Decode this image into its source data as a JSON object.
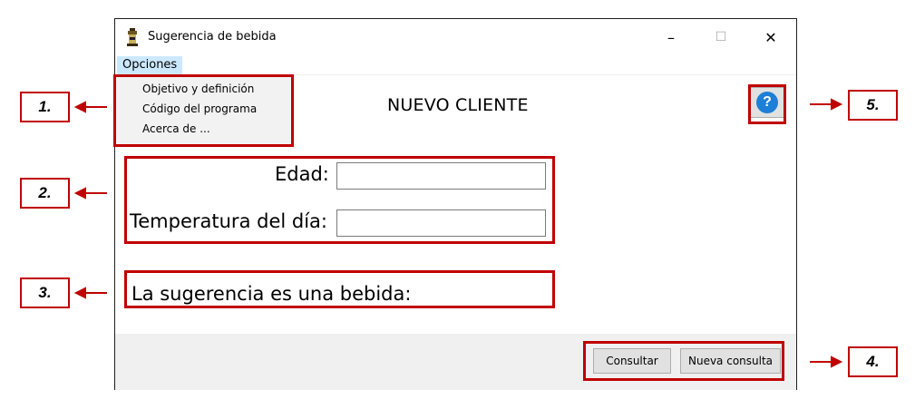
{
  "window": {
    "title": "Sugerencia de bebida",
    "controls": {
      "minimize": "–",
      "maximize": "☐",
      "close": "✕"
    }
  },
  "menu": {
    "label": "Opciones",
    "items": [
      "Objetivo y definición",
      "Código del programa",
      "Acerca de ..."
    ]
  },
  "heading": "NUEVO CLIENTE",
  "help": {
    "icon": "question-icon",
    "glyph": "?"
  },
  "form": {
    "age_label": "Edad:",
    "age_value": "",
    "temp_label": "Temperatura del día:",
    "temp_value": ""
  },
  "result_label": "La sugerencia es una bebida:",
  "buttons": {
    "consult": "Consultar",
    "new_query": "Nueva consulta"
  },
  "annotations": [
    "1.",
    "2.",
    "3.",
    "4.",
    "5."
  ],
  "colors": {
    "annotation_red": "#c00000",
    "menu_highlight": "#cce8ff",
    "help_blue": "#1e7fd6"
  }
}
